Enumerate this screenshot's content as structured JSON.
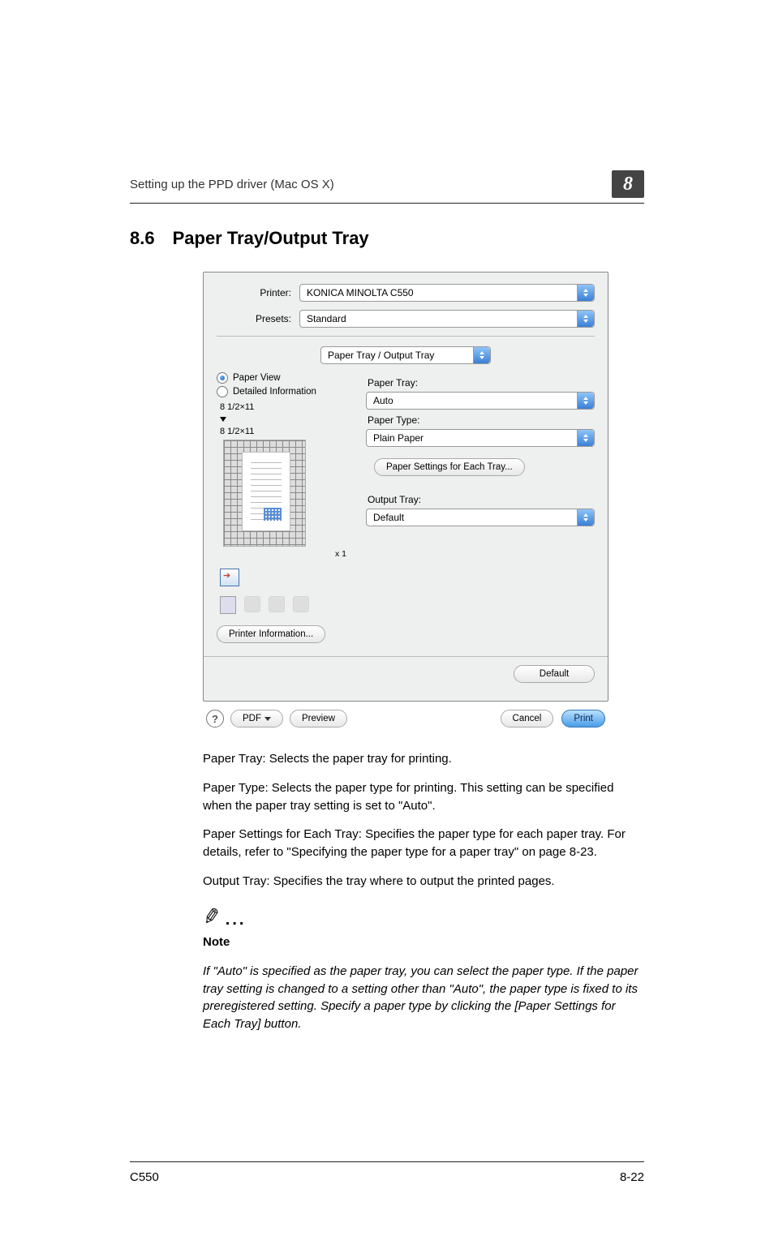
{
  "header": {
    "running_title": "Setting up the PPD driver (Mac OS X)",
    "chapter_badge": "8"
  },
  "section": {
    "number": "8.6",
    "title": "Paper Tray/Output Tray"
  },
  "dialog": {
    "printer_label": "Printer:",
    "printer_value": "KONICA MINOLTA C550",
    "presets_label": "Presets:",
    "presets_value": "Standard",
    "pane_value": "Paper Tray / Output Tray",
    "radio_paper_view": "Paper View",
    "radio_detailed": "Detailed Information",
    "page_size_1": "8 1/2×11",
    "page_size_2": "8 1/2×11",
    "copies_x": "x 1",
    "printer_info_btn": "Printer Information...",
    "paper_tray_label": "Paper Tray:",
    "paper_tray_value": "Auto",
    "paper_type_label": "Paper Type:",
    "paper_type_value": "Plain Paper",
    "each_tray_btn": "Paper Settings for Each Tray...",
    "output_tray_label": "Output Tray:",
    "output_tray_value": "Default",
    "default_btn": "Default",
    "help_icon": "?",
    "pdf_btn": "PDF",
    "preview_btn": "Preview",
    "cancel_btn": "Cancel",
    "print_btn": "Print"
  },
  "body": {
    "p1": "Paper Tray: Selects the paper tray for printing.",
    "p2": "Paper Type: Selects the paper type for printing. This setting can be specified when the paper tray setting is set to \"Auto\".",
    "p3": "Paper Settings for Each Tray: Specifies the paper type for each paper tray. For details, refer to \"Specifying the paper type for a paper tray\" on page 8-23.",
    "p4": "Output Tray: Specifies the tray where to output the printed pages.",
    "note_label": "Note",
    "note_text": "If \"Auto\" is specified as the paper tray, you can select the paper type. If the paper tray setting is changed to a setting other than \"Auto\", the paper type is fixed to its preregistered setting. Specify a paper type by clicking the [Paper Settings for Each Tray] button."
  },
  "footer": {
    "model": "C550",
    "page": "8-22"
  }
}
